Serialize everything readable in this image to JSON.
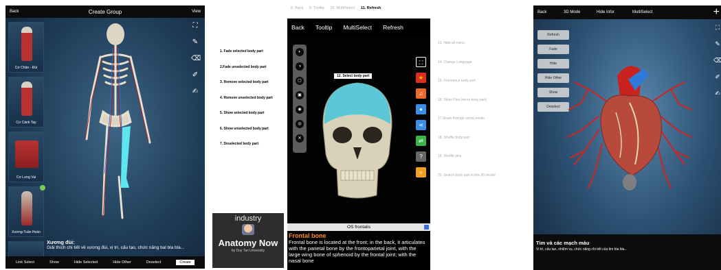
{
  "panel1": {
    "back": "Back",
    "title": "Create Group",
    "view": "View",
    "thumbnails": [
      {
        "label": "Cơ Chân - Đùi"
      },
      {
        "label": "Cơ Cánh Tay"
      },
      {
        "label": "Cơ Lưng Vai"
      },
      {
        "label": "Xương-Tuần Hoàn"
      }
    ],
    "info_title": "Xương đùi:",
    "info_text": "Giải thích chi tiết về xương đùi, vị trí, cấu tạo, chức năng bal bla bla...",
    "bottom": {
      "link_select": "Link Select",
      "show": "Show",
      "hide_selected": "Hide Selected",
      "hide_other": "Hide Other",
      "deselect": "Deselect",
      "create": "Create"
    }
  },
  "panel2": {
    "tabs": [
      "8. Back",
      "9. Tooltip",
      "10. MultiSelect",
      "11. Refresh"
    ],
    "active_tab": "11. Refresh",
    "menu": {
      "back": "Back",
      "tooltip": "Tooltip",
      "multiselect": "MultiSelect",
      "refresh": "Refresh"
    },
    "left_labels": [
      "1. Fade selected body part",
      "2.Fade unselected body part",
      "3. Remove selected body part",
      "4. Remove unselected body part",
      "5. Show selected body part",
      "6. Show unselected body part",
      "7. Deselected body part"
    ],
    "tooltip": "12. Select body part",
    "right_labels": [
      "13. Hide all menu",
      "14. Change Language",
      "15. Pronounce body part",
      "16. Show Pins (micro body part)",
      "17.Share through social media",
      "18. Shuffle body part",
      "19. Shuffle pins",
      "20. Search body part in this 3D model"
    ],
    "structure_name": "OS frontalis",
    "desc_title": "Frontal bone",
    "desc_text": "Frontal bone is located at the front; in the back, it articulates with the parietal bone by the frontoparietal joint, with the large wing bone of sphenoid by the frontal joint; with the nasal bone",
    "logo": {
      "top": "industry",
      "name": "Anatomy Now",
      "by": "by Duy Tan University"
    },
    "side_colors": [
      "#e02b20",
      "#ea6a2b",
      "#3a8ee8",
      "#3a8ee8",
      "#3cb44a",
      "#666666",
      "#f0a020"
    ]
  },
  "panel3": {
    "back": "Back",
    "mode": "3D Mode",
    "hide_infor": "Hide Infor",
    "multiselect": "MultiSelect",
    "menu": [
      "Refresh",
      "Fade",
      "Hide",
      "Hide Other",
      "Show",
      "Deselect"
    ],
    "title": "Tim và các mạch máu",
    "subtitle": "Vị trí, cấu tạo, nhiệm vụ, chức năng chi tiết của tim bla bla..."
  }
}
